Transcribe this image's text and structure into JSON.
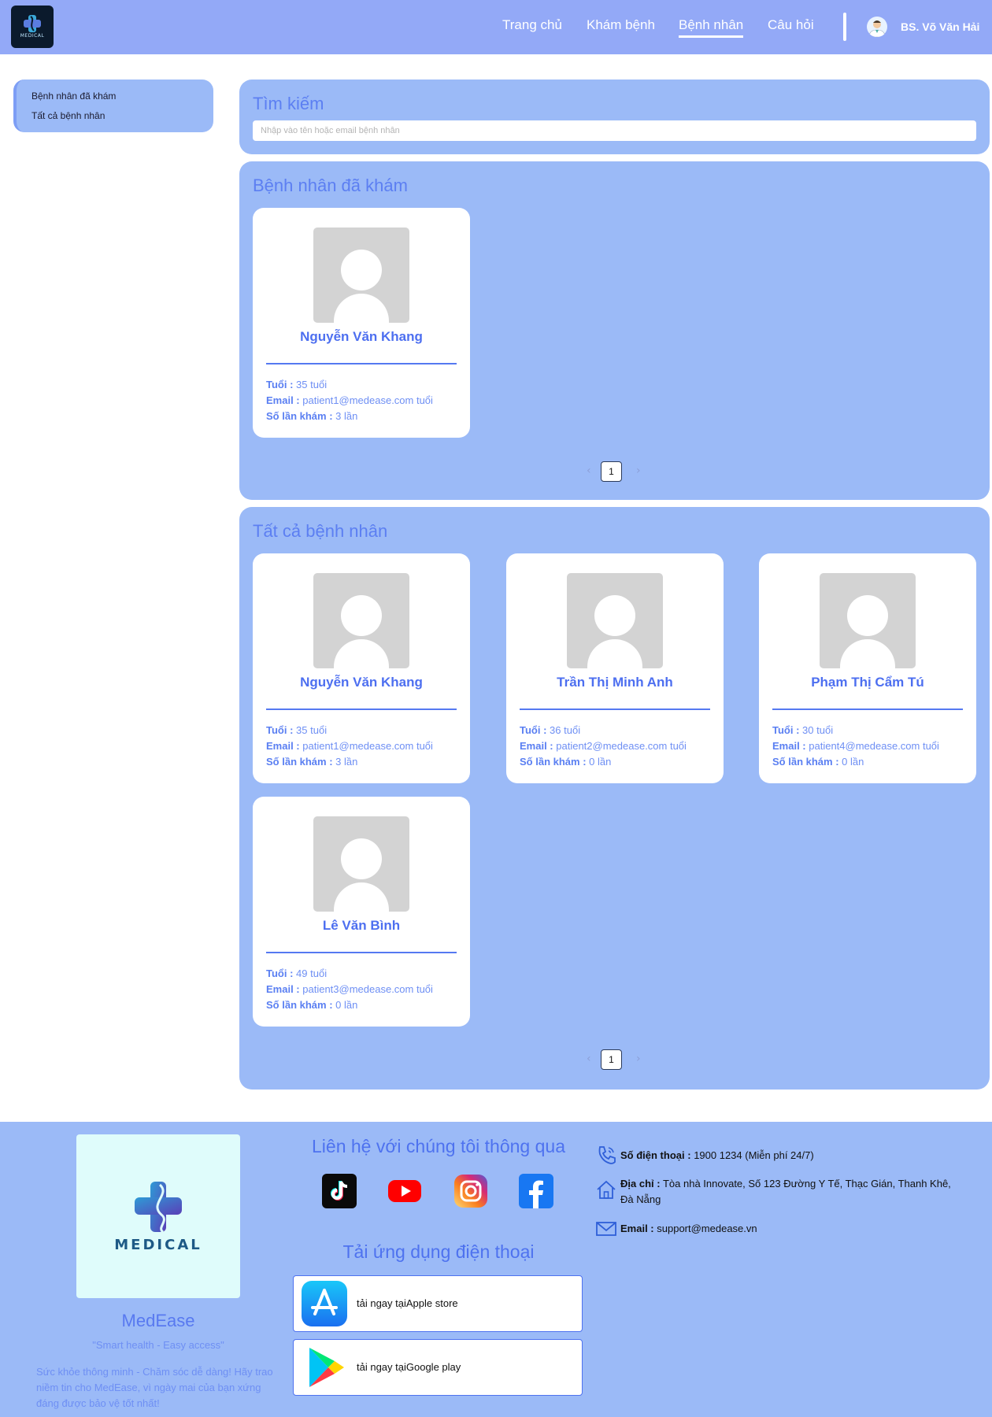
{
  "header": {
    "logo_text": "MEDICAL",
    "nav": [
      {
        "label": "Trang chủ"
      },
      {
        "label": "Khám bệnh"
      },
      {
        "label": "Bệnh nhân",
        "active": true
      },
      {
        "label": "Câu hỏi"
      }
    ],
    "user_name": "BS. Võ Văn Hải"
  },
  "sidebar": {
    "items": [
      {
        "label": "Bệnh nhân đã khám"
      },
      {
        "label": "Tất cả bệnh nhân"
      }
    ]
  },
  "search": {
    "title": "Tìm kiếm",
    "placeholder": "Nhập vào tên hoặc email bệnh nhân"
  },
  "examined": {
    "title": "Bệnh nhân đã khám",
    "patients": [
      {
        "name": "Nguyễn Văn Khang",
        "age_label": "Tuổi :",
        "age": "35 tuổi",
        "email_label": "Email :",
        "email": "patient1@medease.com tuổi",
        "visits_label": "Số lần khám :",
        "visits": "3 lần"
      }
    ],
    "pager": {
      "prev": "‹",
      "page": "1",
      "next": "›"
    }
  },
  "all_patients": {
    "title": "Tất cả bệnh nhân",
    "patients": [
      {
        "name": "Nguyễn Văn Khang",
        "age_label": "Tuổi :",
        "age": "35 tuổi",
        "email_label": "Email :",
        "email": "patient1@medease.com tuổi",
        "visits_label": "Số lần khám :",
        "visits": "3 lần"
      },
      {
        "name": "Trần Thị Minh Anh",
        "age_label": "Tuổi :",
        "age": "36 tuổi",
        "email_label": "Email :",
        "email": "patient2@medease.com tuổi",
        "visits_label": "Số lần khám :",
        "visits": "0 lần"
      },
      {
        "name": "Phạm Thị Cẩm Tú",
        "age_label": "Tuổi :",
        "age": "30 tuổi",
        "email_label": "Email :",
        "email": "patient4@medease.com tuổi",
        "visits_label": "Số lần khám :",
        "visits": "0 lần"
      },
      {
        "name": "Lê Văn Bình",
        "age_label": "Tuổi :",
        "age": "49 tuổi",
        "email_label": "Email :",
        "email": "patient3@medease.com tuổi",
        "visits_label": "Số lần khám :",
        "visits": "0 lần"
      }
    ],
    "pager": {
      "prev": "‹",
      "page": "1",
      "next": "›"
    }
  },
  "footer": {
    "logo_text": "MEDICAL",
    "brand": "MedEase",
    "slogan": "\"Smart health - Easy access\"",
    "description": "Sức khỏe thông minh - Chăm sóc dễ dàng! Hãy trao niềm tin cho MedEase, vì ngày mai của bạn xứng đáng được bảo vệ tốt nhất!",
    "contact_title": "Liên hệ với chúng tôi thông qua",
    "socials": [
      "tiktok-icon",
      "youtube-icon",
      "instagram-icon",
      "facebook-icon"
    ],
    "app_title": "Tải ứng dụng điện thoại",
    "apple_label": "tải ngay tạiApple store",
    "google_label": "tải ngay tạiGoogle play",
    "phone_label": "Số điện thoại :",
    "phone": "1900 1234 (Miễn phí 24/7)",
    "address_label": "Địa chỉ :",
    "address": "Tòa nhà Innovate, Số 123 Đường Y Tế, Thạc Gián, Thanh Khê, Đà Nẵng",
    "email_label": "Email :",
    "email": "support@medease.vn"
  },
  "colors": {
    "header_bg": "#93a9f7",
    "panel_bg": "#9bbaf7",
    "accent": "#4d6ff0"
  }
}
